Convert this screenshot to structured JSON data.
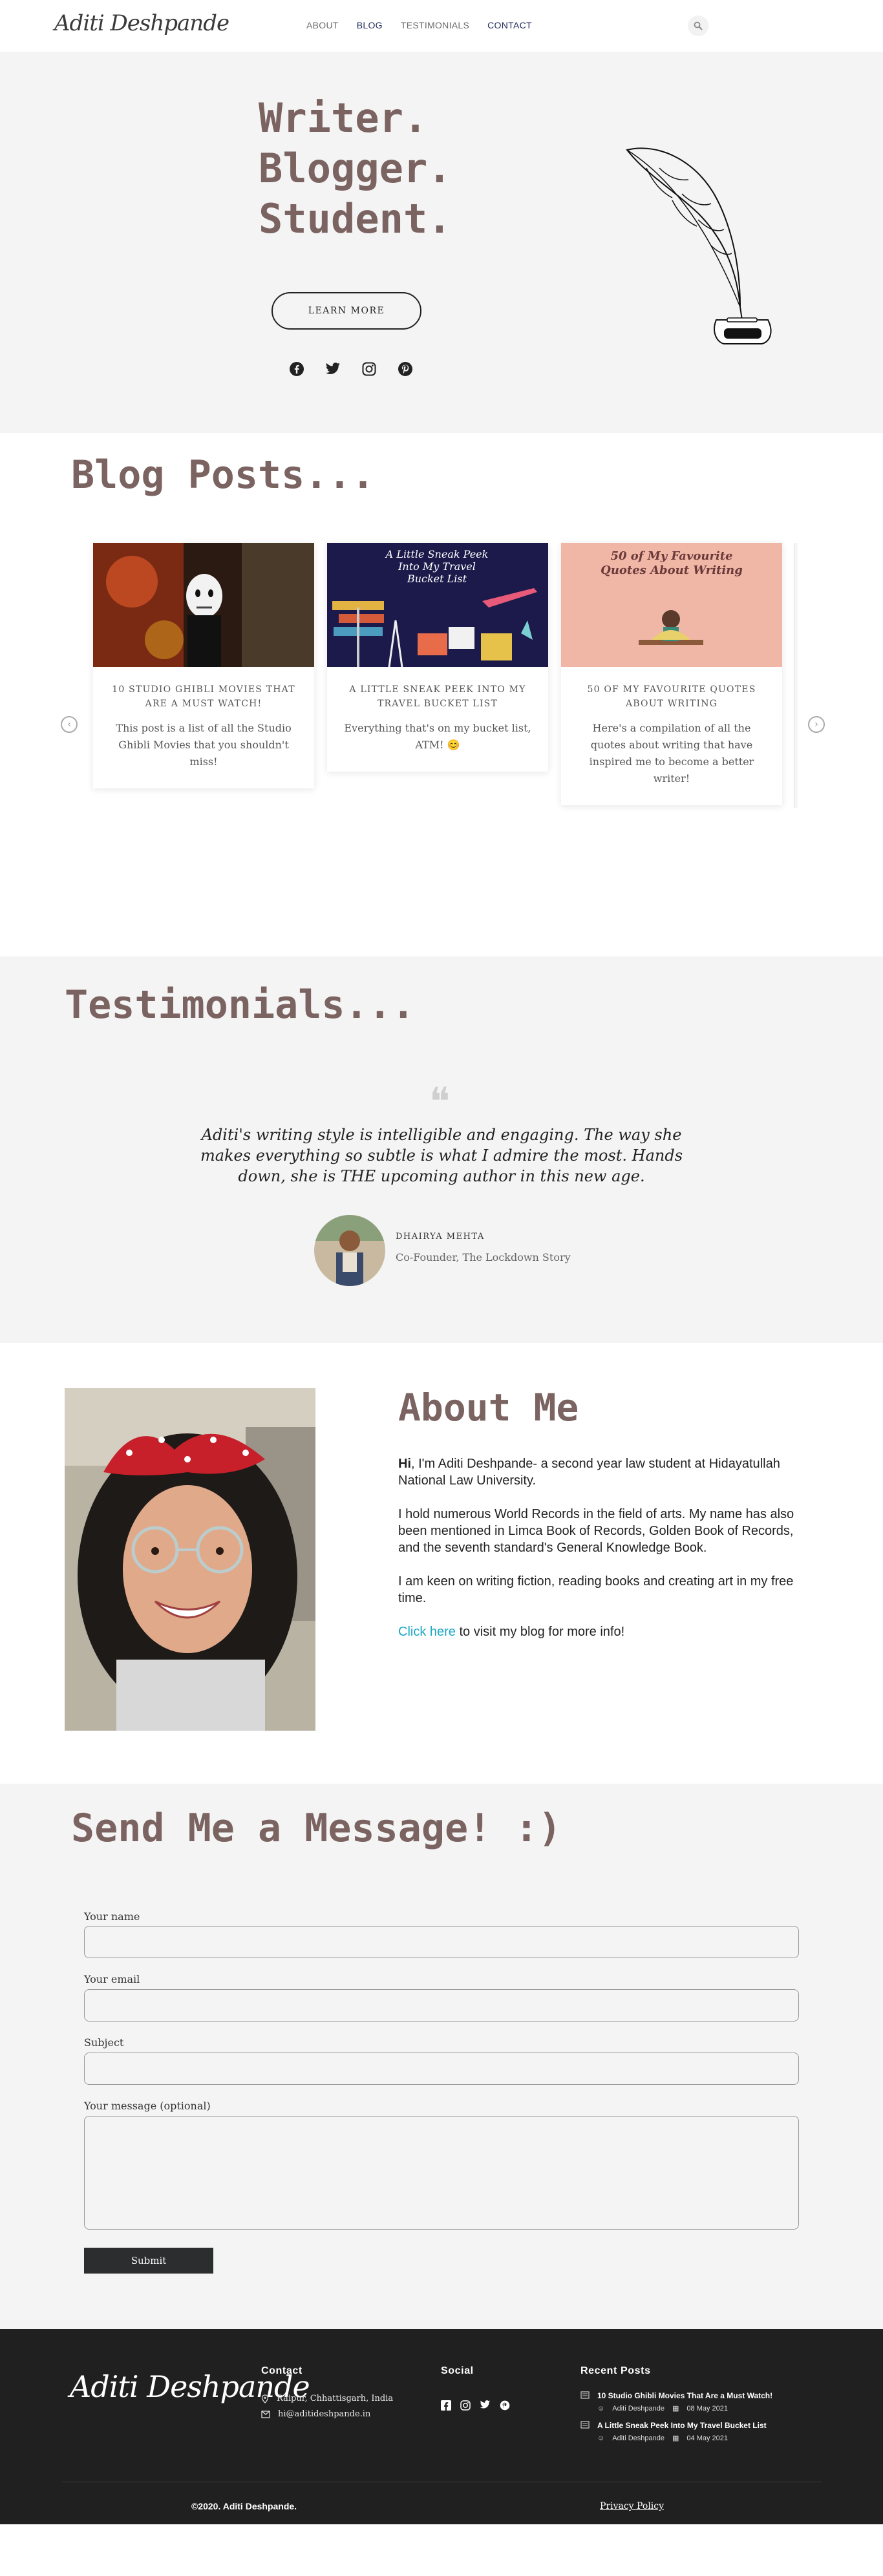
{
  "header": {
    "logo": "Aditi Deshpande",
    "nav": [
      {
        "label": "ABOUT"
      },
      {
        "label": "BLOG"
      },
      {
        "label": "TESTIMONIALS"
      },
      {
        "label": "CONTACT"
      }
    ]
  },
  "hero": {
    "lines": [
      "Writer.",
      "Blogger.",
      "Student."
    ],
    "button": "LEARN MORE"
  },
  "blog": {
    "title": "Blog Posts...",
    "cards": [
      {
        "title": "10 STUDIO GHIBLI MOVIES THAT ARE A MUST WATCH!",
        "excerpt": "This post is a list of all the Studio Ghibli Movies that you shouldn't miss!"
      },
      {
        "image_text": "A Little Sneak Peek Into My Travel Bucket List",
        "title": "A LITTLE SNEAK PEEK INTO MY TRAVEL BUCKET LIST",
        "excerpt": "Everything that's on my bucket list, ATM! 😊"
      },
      {
        "image_text": "50 of My Favourite Quotes About Writing",
        "title": "50 OF MY FAVOURITE QUOTES ABOUT WRITING",
        "excerpt": "Here's a compilation of all the quotes about writing that have inspired me to become a better writer!"
      }
    ]
  },
  "testimonials": {
    "title": "Testimonials...",
    "quote": "Aditi's writing style is intelligible and engaging. The way she makes everything so subtle is what I admire the most. Hands down, she is THE upcoming author in this new age.",
    "name": "DHAIRYA MEHTA",
    "role": "Co-Founder, The Lockdown Story"
  },
  "about": {
    "title": "About Me",
    "p1_bold": "Hi",
    "p1_rest": ", I'm Aditi Deshpande- a second year law student at Hidayatullah National Law University.",
    "p2": "I hold numerous World Records in the field of arts. My name has also been mentioned in Limca Book of Records, Golden Book of Records, and the seventh standard's General Knowledge Book.",
    "p3": "I am keen on writing fiction, reading books and creating art in my free time.",
    "link": "Click here",
    "link_rest": " to visit my blog for more info!"
  },
  "contact": {
    "title": "Send Me a Message! :)",
    "fields": {
      "name_label": "Your name",
      "email_label": "Your email",
      "subject_label": "Subject",
      "message_label": "Your message (optional)"
    },
    "submit": "Submit"
  },
  "footer": {
    "logo": "Aditi Deshpande",
    "contact_heading": "Contact",
    "address": "Raipur, Chhattisgarh, India",
    "email": "hi@aditideshpande.in",
    "social_heading": "Social",
    "recent_heading": "Recent Posts",
    "posts": [
      {
        "title": "10 Studio Ghibli Movies That Are a Must Watch!",
        "author": "Aditi Deshpande",
        "date": "08 May 2021"
      },
      {
        "title": "A Little Sneak Peek Into My Travel Bucket List",
        "author": "Aditi Deshpande",
        "date": "04 May 2021"
      }
    ],
    "copyright": "©2020. Aditi Deshpande.",
    "privacy": "Privacy Policy"
  },
  "colors": {
    "heading": "#7a6360",
    "section_bg": "#f4f4f4",
    "footer_bg": "#202020",
    "link": "#1aa7c4",
    "nav_active": "#1f2a5a"
  }
}
